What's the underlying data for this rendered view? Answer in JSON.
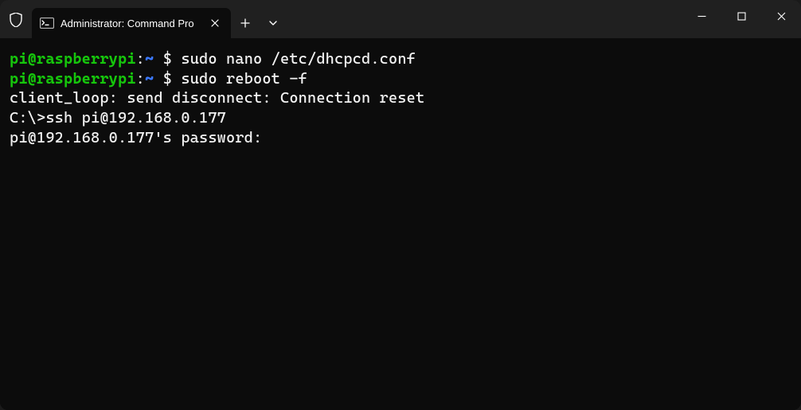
{
  "tab": {
    "title": "Administrator: Command Pro"
  },
  "terminal": {
    "lines": [
      {
        "prompt_user": "pi@raspberrypi",
        "prompt_sep": ":",
        "prompt_path": "~",
        "prompt_dollar": " $ ",
        "command": "sudo nano /etc/dhcpcd.conf"
      },
      {
        "prompt_user": "pi@raspberrypi",
        "prompt_sep": ":",
        "prompt_path": "~",
        "prompt_dollar": " $ ",
        "command": "sudo reboot -f"
      },
      {
        "plain": "client_loop: send disconnect: Connection reset"
      },
      {
        "plain": ""
      },
      {
        "plain": "C:\\>ssh pi@192.168.0.177"
      },
      {
        "plain": "pi@192.168.0.177's password:"
      }
    ]
  }
}
